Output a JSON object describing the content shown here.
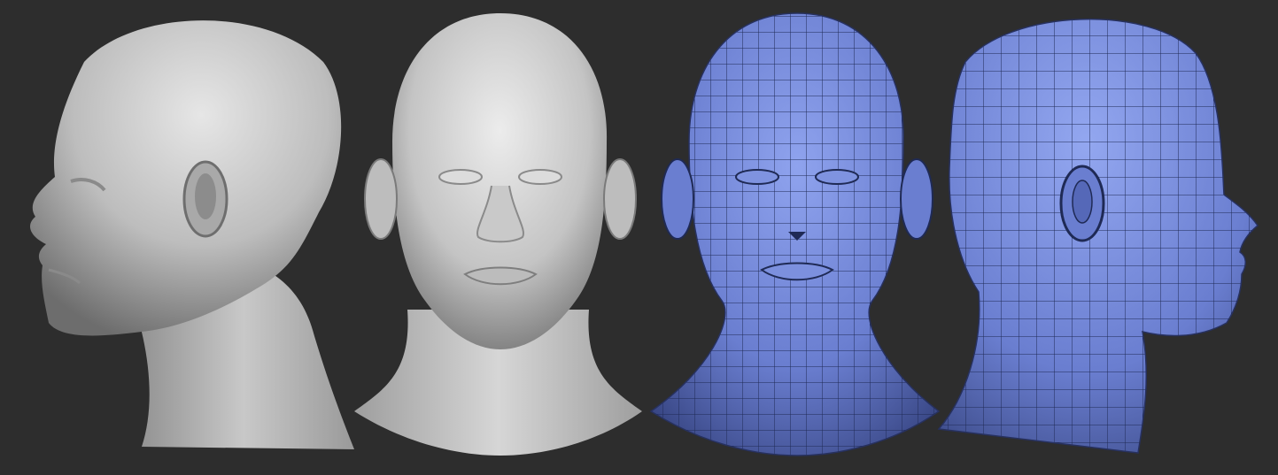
{
  "scene": {
    "background_color": "#2d2d2d",
    "views": [
      {
        "name": "side-profile-clay",
        "shading": "clay",
        "facing": "left",
        "color": "#cfcfcf"
      },
      {
        "name": "front-clay",
        "shading": "clay",
        "facing": "front",
        "color": "#d4d4d4"
      },
      {
        "name": "front-wireframe",
        "shading": "polygroup-wireframe",
        "facing": "front",
        "color": "#6a7ed0"
      },
      {
        "name": "side-wireframe",
        "shading": "polygroup-wireframe",
        "facing": "right",
        "color": "#6a7ed0"
      }
    ]
  }
}
